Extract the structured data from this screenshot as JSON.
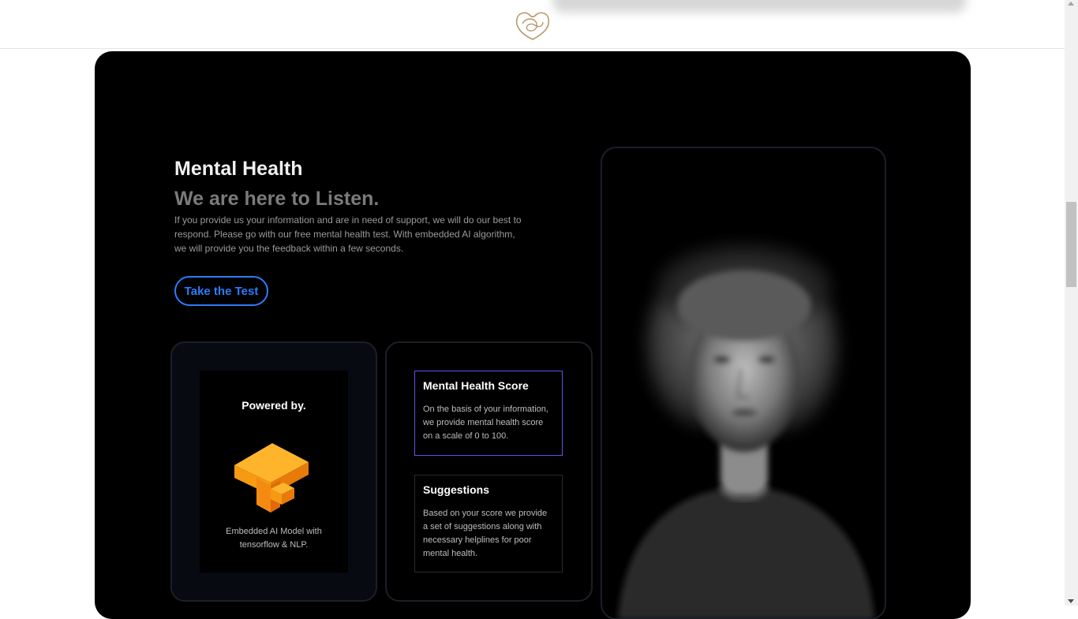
{
  "header": {
    "logo_icon": "heart-outline-logo-icon"
  },
  "hero": {
    "title": "Mental Health",
    "subtitle": "We are here to Listen.",
    "description": "If you provide us your information and are in need of support, we will do our best to respond. Please go with our free mental health test. With embedded AI algorithm, we will provide you the feedback within a few seconds.",
    "cta_label": "Take the Test"
  },
  "powered": {
    "title": "Powered by.",
    "logo_icon": "tensorflow-logo-icon",
    "description": "Embedded AI Model with tensorflow & NLP."
  },
  "features": [
    {
      "title": "Mental Health Score",
      "text": "On the basis of your information, we provide mental health score on a scale of 0 to 100."
    },
    {
      "title": "Suggestions",
      "text": "Based on your score we provide a set of suggestions along with necessary helplines for poor mental health."
    }
  ],
  "colors": {
    "accent": "#2c7df7",
    "highlight_border": "#5b55e6",
    "background": "#000000"
  }
}
